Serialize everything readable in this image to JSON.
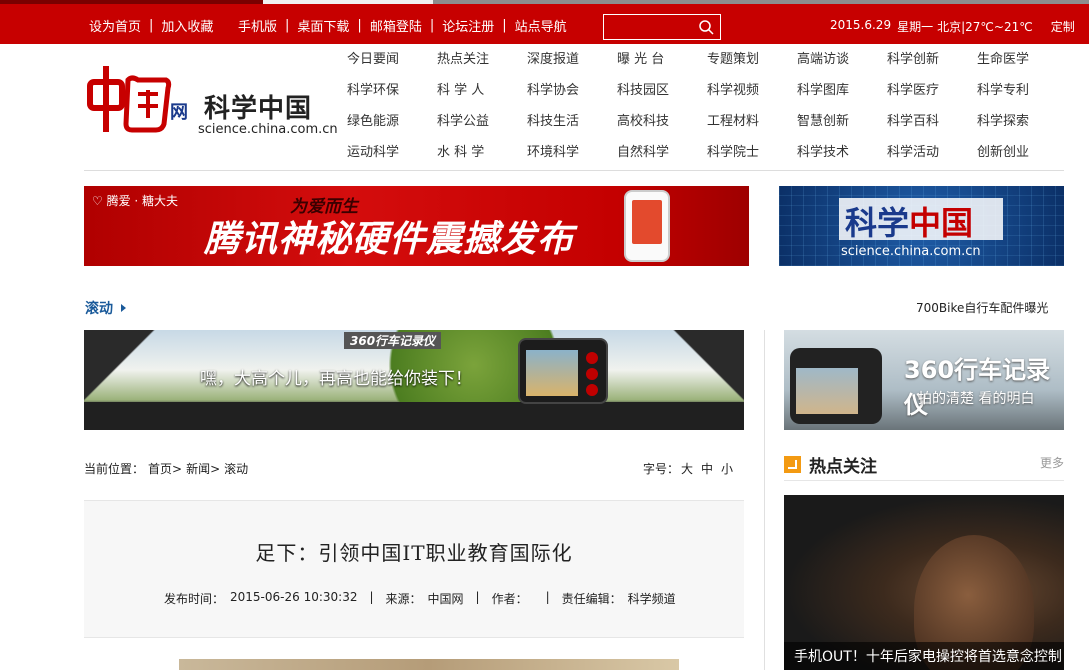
{
  "topbar": {
    "set_home": "设为首页",
    "add_fav": "加入收藏",
    "mobile": "手机版",
    "desktop_download": "桌面下载",
    "mail_login": "邮箱登陆",
    "forum_register": "论坛注册",
    "site_nav": "站点导航",
    "search_placeholder": "",
    "date": "2015.6.29",
    "weekday": "星期一",
    "weather": "北京|27℃~21℃",
    "customize": "定制"
  },
  "logo": {
    "wang": "网",
    "name": "科学中国",
    "url": "science.china.com.cn"
  },
  "nav": [
    "今日要闻",
    "热点关注",
    "深度报道",
    "曝 光 台",
    "专题策划",
    "高端访谈",
    "科学创新",
    "生命医学",
    "科学环保",
    "科 学 人",
    "科学协会",
    "科技园区",
    "科学视频",
    "科学图库",
    "科学医疗",
    "科学专利",
    "绿色能源",
    "科学公益",
    "科技生活",
    "高校科技",
    "工程材料",
    "智慧创新",
    "科学百科",
    "科学探索",
    "运动科学",
    "水 科 学",
    "环境科学",
    "自然科学",
    "科学院士",
    "科学技术",
    "科学活动",
    "创新创业"
  ],
  "ad1": {
    "brand": "♡ 腾爱 · 糖大夫",
    "slogan": "为爱而生",
    "main_a": "腾讯神秘硬件",
    "main_b": "震撼发布"
  },
  "ad2": {
    "text_a": "科学",
    "text_b": "中国",
    "url": "science.china.com.cn"
  },
  "scroll": {
    "label": "滚动",
    "news": "700Bike自行车配件曝光"
  },
  "banner": {
    "brand": "360行车记录仪",
    "caption": "嘿，大高个儿，再高也能给你装下！"
  },
  "sidead": {
    "title": "360行车记录仪",
    "subtitle": "拍的清楚 看的明白"
  },
  "crumb": {
    "label": "当前位置：",
    "home": "首页>",
    "news": "新闻>",
    "scroll": "滚动"
  },
  "fontsize": {
    "label": "字号：",
    "large": "大",
    "medium": "中",
    "small": "小"
  },
  "article": {
    "title": "足下：引领中国IT职业教育国际化",
    "publish_label": "发布时间：",
    "publish_time": "2015-06-26 10:30:32",
    "source_label": "来源：",
    "source": "中国网",
    "author_label": "作者：",
    "author": "",
    "editor_label": "责任编辑：",
    "editor": "科学频道"
  },
  "hot": {
    "title": "热点关注",
    "more": "更多",
    "caption": "手机OUT！十年后家电操控将首选意念控制"
  },
  "colors": {
    "brand_red": "#c70000",
    "link_blue": "#1a5a9a",
    "hot_orange": "#f39a12"
  }
}
